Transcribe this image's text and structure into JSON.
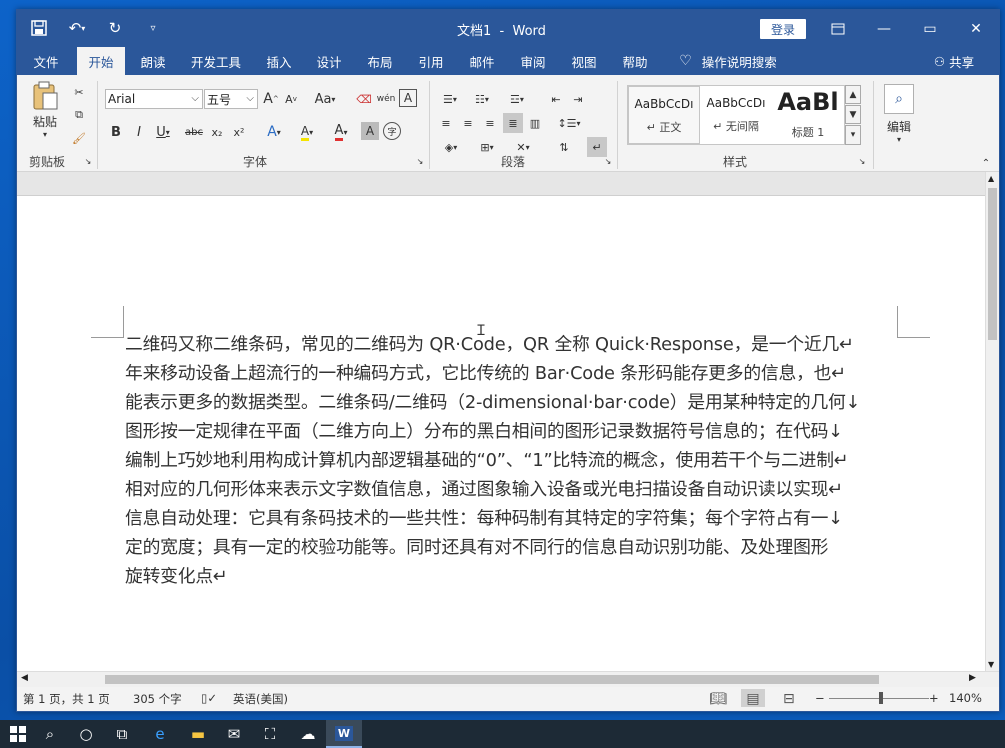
{
  "window": {
    "title": "文档1  -  Word",
    "login_label": "登录",
    "minimize_icon": "—",
    "restore_icon": "▭",
    "close_icon": "✕"
  },
  "quick_access": {
    "save_icon": "save-icon",
    "undo_icon": "undo-icon",
    "redo_icon": "redo-icon",
    "customize_icon": "chevron-down-icon"
  },
  "menu": {
    "tabs": [
      "文件",
      "开始",
      "朗读",
      "开发工具",
      "插入",
      "设计",
      "布局",
      "引用",
      "邮件",
      "审阅",
      "视图",
      "帮助"
    ],
    "active_index": 1,
    "search_label": "操作说明搜索",
    "share_label": "共享"
  },
  "ribbon": {
    "clipboard": {
      "label": "剪贴板",
      "paste_label": "粘贴"
    },
    "font": {
      "label": "字体",
      "font_name": "Arial",
      "font_size": "五号",
      "bold": "B",
      "italic": "I",
      "underline": "U",
      "strike": "abc",
      "sub": "x₂",
      "sup": "x²",
      "case_label": "Aa",
      "grow": "A",
      "shrink": "A",
      "pinyin": "wén",
      "border_char": "A",
      "text_effect": "A",
      "font_color": "A",
      "shading": "A",
      "enclose": "字"
    },
    "paragraph": {
      "label": "段落"
    },
    "styles": {
      "label": "样式",
      "items": [
        {
          "preview": "AaBbCcDı",
          "name": "↵ 正文"
        },
        {
          "preview": "AaBbCcDı",
          "name": "↵ 无间隔"
        },
        {
          "preview": "AaBl",
          "name": "标题 1"
        }
      ]
    },
    "editing": {
      "label": "编辑"
    }
  },
  "document": {
    "lines": [
      "二维码又称二维条码，常见的二维码为 QR·Code，QR 全称 Quick·Response，是一个近几↵",
      "年来移动设备上超流行的一种编码方式，它比传统的 Bar·Code 条形码能存更多的信息，也↵",
      "能表示更多的数据类型。二维条码/二维码（2-dimensional·bar·code）是用某种特定的几何↓",
      "图形按一定规律在平面（二维方向上）分布的黑白相间的图形记录数据符号信息的；在代码↓",
      "编制上巧妙地利用构成计算机内部逻辑基础的“0”、“1”比特流的概念，使用若干个与二进制↵",
      "相对应的几何形体来表示文字数值信息，通过图象输入设备或光电扫描设备自动识读以实现↵",
      "信息自动处理：它具有条码技术的一些共性：每种码制有其特定的字符集；每个字符占有一↓",
      "定的宽度；具有一定的校验功能等。同时还具有对不同行的信息自动识别功能、及处理图形",
      "旋转变化点↵"
    ]
  },
  "status": {
    "page": "第 1 页，共 1 页",
    "words": "305 个字",
    "language": "英语(美国)",
    "zoom": "140%"
  },
  "colors": {
    "accent": "#2b579a",
    "desktop": "#0d63c9",
    "taskbar": "#1d2a36"
  }
}
